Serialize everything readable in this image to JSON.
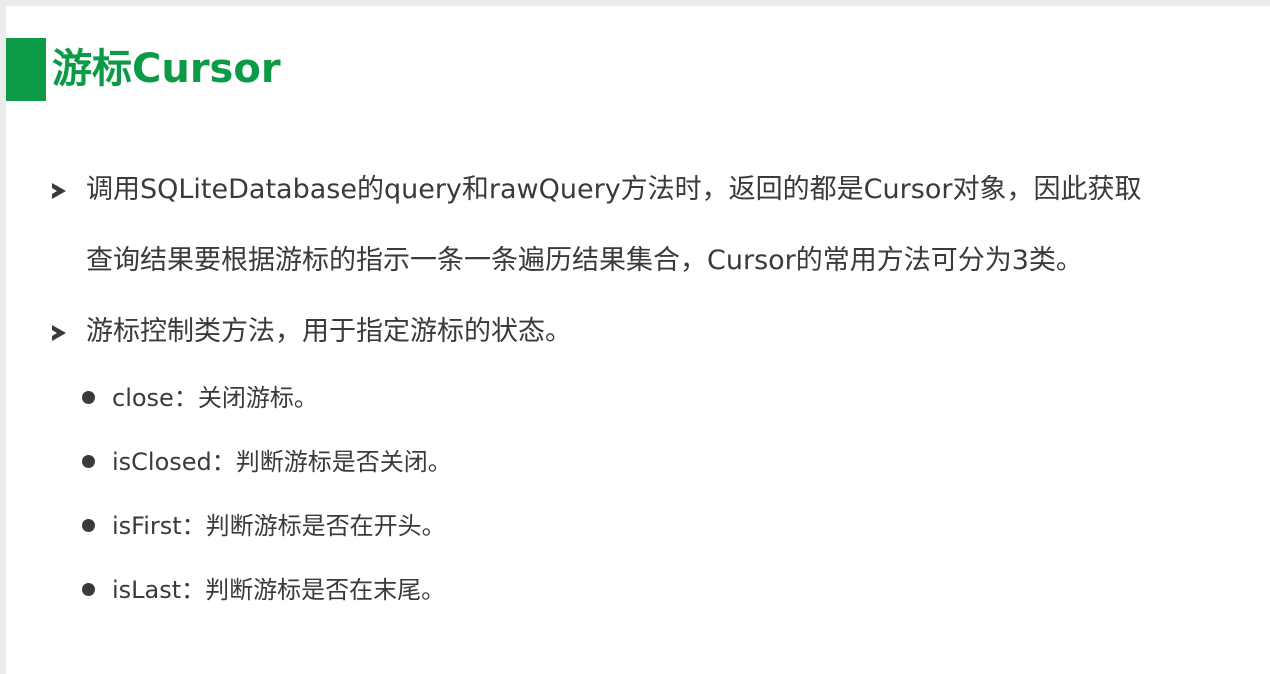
{
  "slide": {
    "title": "游标Cursor",
    "points": [
      {
        "line1": "调用SQLiteDatabase的query和rawQuery方法时，返回的都是Cursor对象，因此获取",
        "line2": "查询结果要根据游标的指示一条一条遍历结果集合，Cursor的常用方法可分为3类。"
      },
      {
        "line1": "游标控制类方法，用于指定游标的状态。"
      }
    ],
    "methods": [
      {
        "text": "close：关闭游标。"
      },
      {
        "text": "isClosed：判断游标是否关闭。"
      },
      {
        "text": "isFirst：判断游标是否在开头。"
      },
      {
        "text": "isLast：判断游标是否在末尾。"
      }
    ]
  },
  "colors": {
    "accent": "#0b9a46",
    "text": "#3a3a3a"
  }
}
